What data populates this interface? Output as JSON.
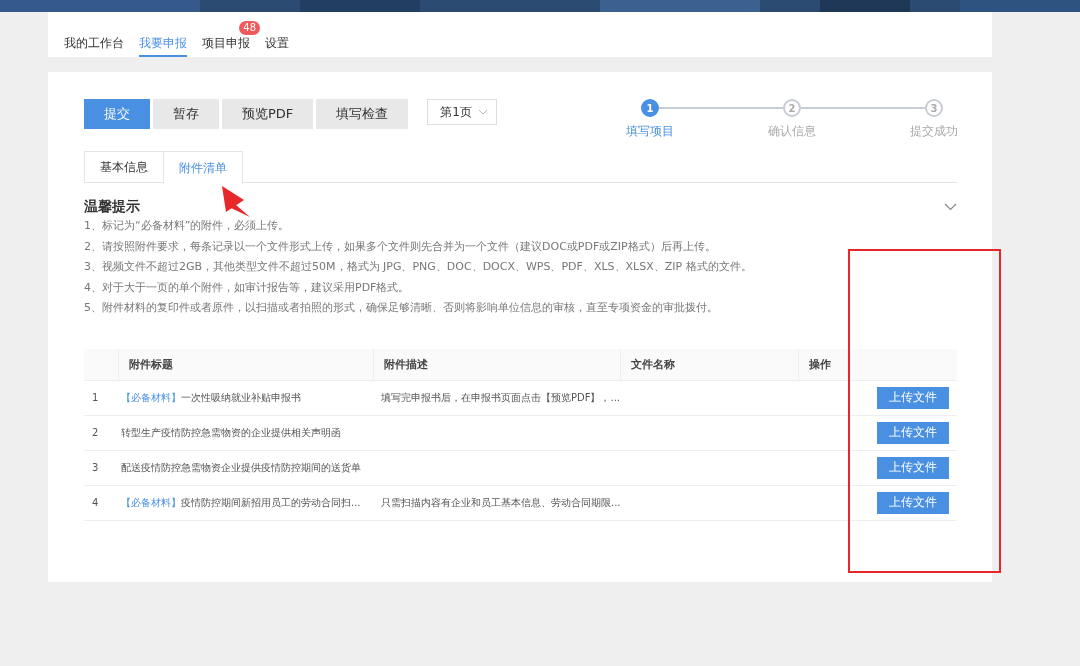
{
  "nav": [
    {
      "label": "我的工作台",
      "selected": false
    },
    {
      "label": "我要申报",
      "selected": true
    },
    {
      "label": "项目申报",
      "selected": false,
      "badge": "48"
    },
    {
      "label": "设置",
      "selected": false
    }
  ],
  "toolbar": {
    "buttons": [
      {
        "label": "提交",
        "kind": "primary"
      },
      {
        "label": "暂存",
        "kind": "default"
      },
      {
        "label": "预览PDF",
        "kind": "default"
      },
      {
        "label": "填写检查",
        "kind": "default"
      }
    ],
    "page_select": {
      "value": "第1页"
    }
  },
  "steps": [
    {
      "number": "1",
      "label": "填写项目",
      "selected": true
    },
    {
      "number": "2",
      "label": "确认信息",
      "selected": false
    },
    {
      "number": "3",
      "label": "提交成功",
      "selected": false
    }
  ],
  "tabs": [
    {
      "label": "基本信息",
      "selected": false
    },
    {
      "label": "附件清单",
      "selected": true
    }
  ],
  "tips": {
    "title": "温馨提示",
    "lines": [
      "1、标记为“必备材料”的附件，必须上传。",
      "2、请按照附件要求，每条记录以一个文件形式上传，如果多个文件则先合并为一个文件（建议DOC或PDF或ZIP格式）后再上传。",
      "3、视频文件不超过2GB，其他类型文件不超过50M，格式为 JPG、PNG、DOC、DOCX、WPS、PDF、XLS、XLSX、ZIP 格式的文件。",
      "4、对于大于一页的单个附件，如审计报告等，建议采用PDF格式。",
      "5、附件材料的复印件或者原件，以扫描或者拍照的形式，确保足够清晰、否则将影响单位信息的审核，直至专项资金的审批拨付。"
    ]
  },
  "table": {
    "columns": [
      "附件标题",
      "附件描述",
      "文件名称",
      "操作"
    ],
    "rows": [
      {
        "index": "1",
        "tag": "【必备材料】",
        "title": "一次性吸纳就业补贴申报书",
        "description": "填写完申报书后，在申报书页面点击【预览PDF】，...",
        "action": "上传文件"
      },
      {
        "index": "2",
        "title": "转型生产疫情防控急需物资的企业提供相关声明函",
        "action": "上传文件"
      },
      {
        "index": "3",
        "title": "配送疫情防控急需物资企业提供疫情防控期间的送货单",
        "action": "上传文件"
      },
      {
        "index": "4",
        "tag": "【必备材料】",
        "title": "疫情防控期间新招用员工的劳动合同扫...",
        "description": "只需扫描内容有企业和员工基本信息、劳动合同期限...",
        "action": "上传文件"
      }
    ]
  }
}
